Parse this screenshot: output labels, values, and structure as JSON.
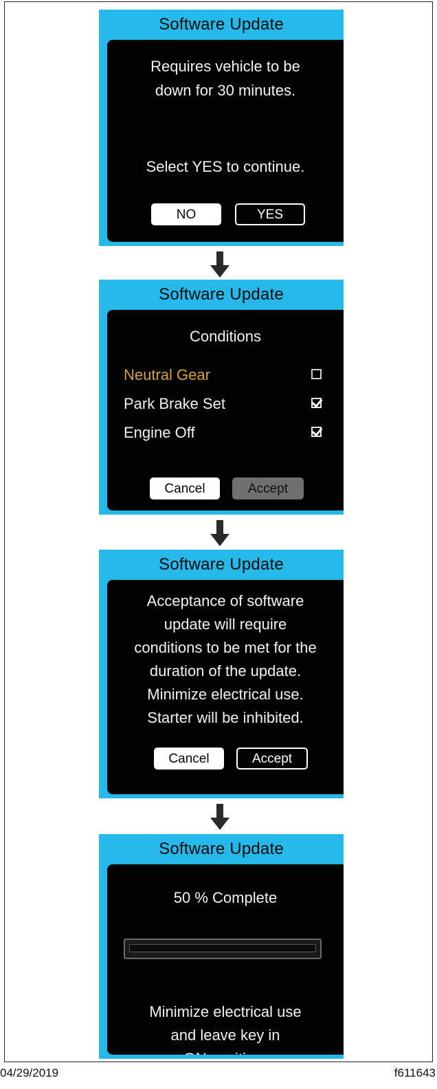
{
  "screens": [
    {
      "title": "Software Update",
      "lines": [
        "Requires vehicle to be",
        "down for 30 minutes."
      ],
      "prompt": "Select YES to continue.",
      "buttons": {
        "no": "NO",
        "yes": "YES"
      }
    },
    {
      "title": "Software Update",
      "heading": "Conditions",
      "conditions": [
        {
          "label": "Neutral Gear",
          "checked": false,
          "color": "#d8a03a"
        },
        {
          "label": "Park Brake Set",
          "checked": true,
          "color": "#f2f2f2"
        },
        {
          "label": "Engine Off",
          "checked": true,
          "color": "#f2f2f2"
        }
      ],
      "buttons": {
        "cancel": "Cancel",
        "accept": "Accept"
      }
    },
    {
      "title": "Software Update",
      "lines": [
        "Acceptance of software",
        "update will require",
        "conditions to be met for the",
        "duration of the update.",
        "Minimize electrical use.",
        "Starter will be inhibited."
      ],
      "buttons": {
        "cancel": "Cancel",
        "accept": "Accept"
      }
    },
    {
      "title": "Software Update",
      "progress_label": "50 % Complete",
      "progress_fraction": 0.5,
      "lines": [
        "Minimize electrical use",
        "and leave key in",
        "ON position."
      ]
    }
  ],
  "footer": {
    "date": "04/29/2019",
    "figure_id": "f611643"
  },
  "colors": {
    "header": "#27b8ea",
    "screen": "#020202",
    "warning": "#d8a03a"
  },
  "icons": [
    "down-arrow-icon",
    "checkbox-icon"
  ]
}
